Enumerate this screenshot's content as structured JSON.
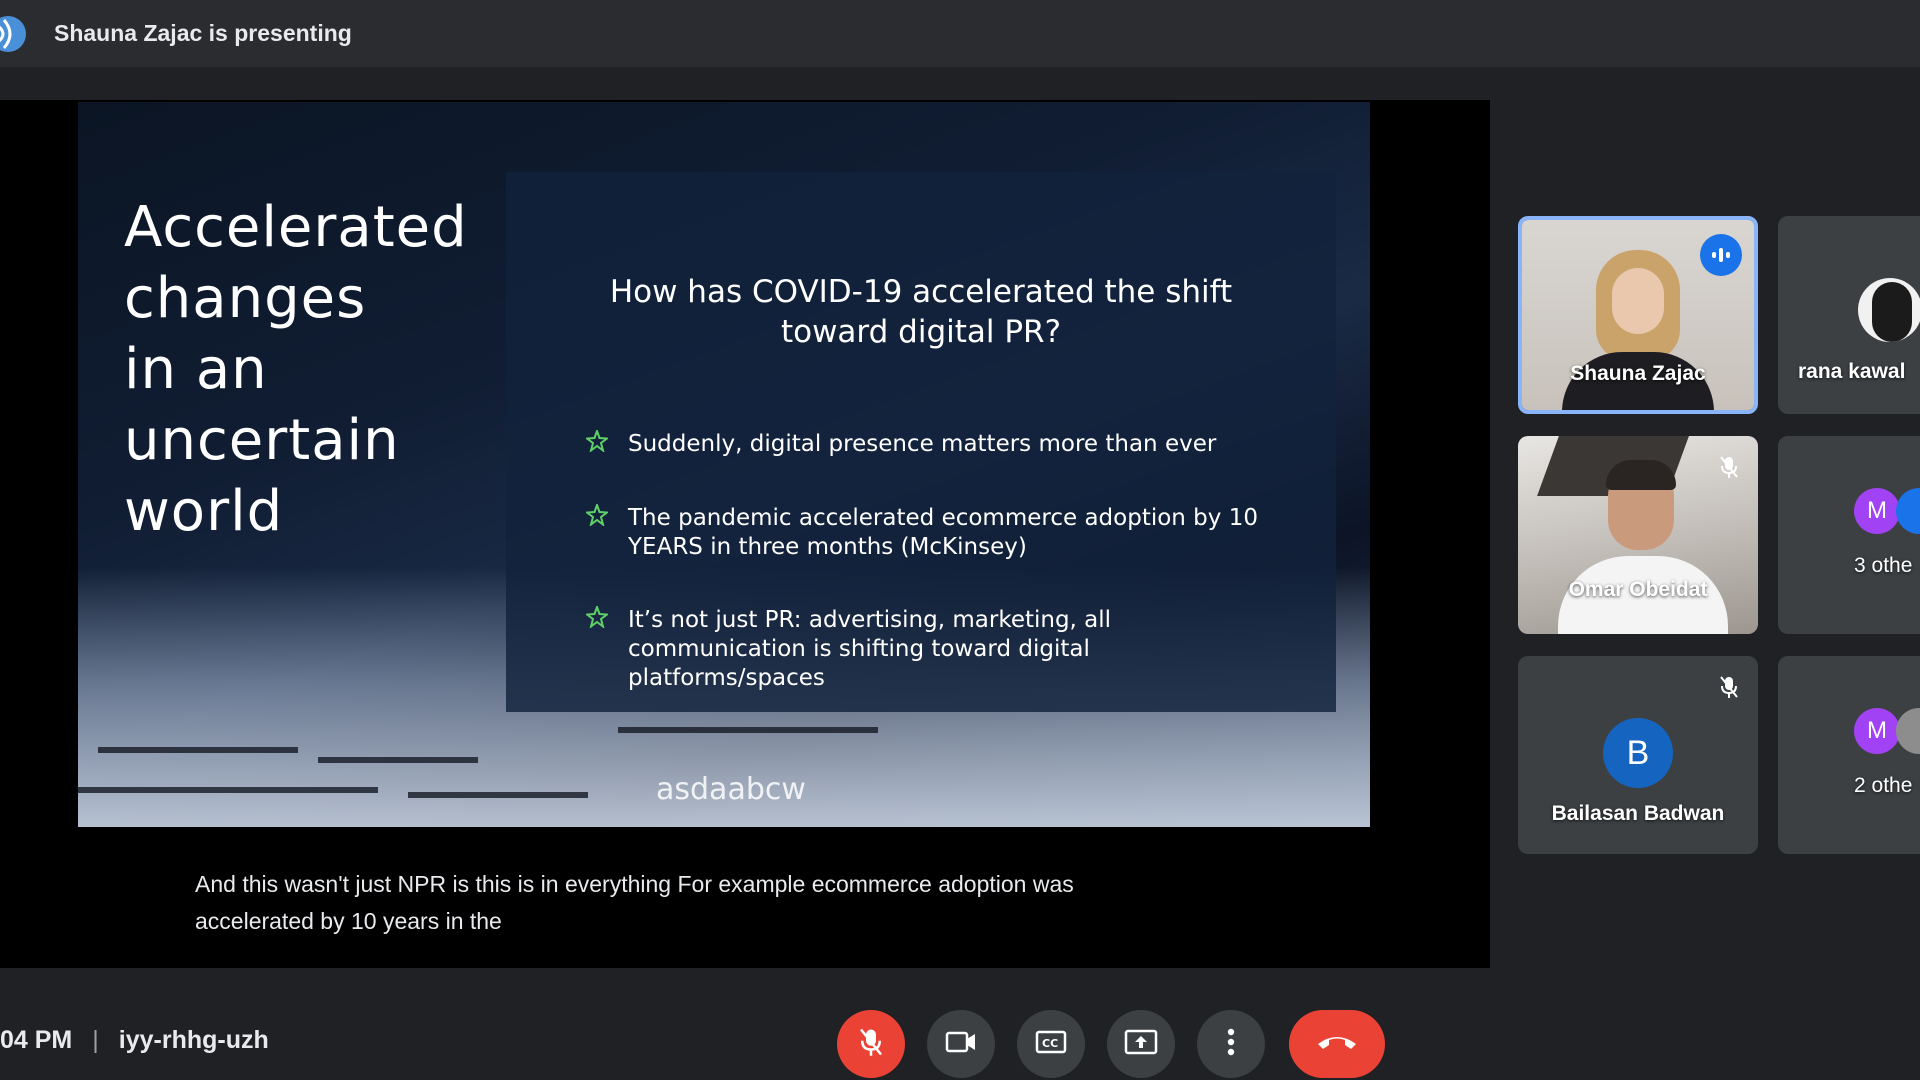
{
  "topbar": {
    "presenting": "Shauna Zajac is presenting"
  },
  "slide": {
    "title_lines": [
      "Accelerated",
      "changes",
      "in an",
      "uncertain",
      "world"
    ],
    "question": "How has COVID-19 accelerated the shift toward digital PR?",
    "bullets": [
      "Suddenly, digital presence matters more than ever",
      "The pandemic accelerated ecommerce adoption by 10 YEARS in three months (McKinsey)",
      "It’s not just PR: advertising, marketing, all communication is shifting toward digital platforms/spaces"
    ],
    "logo": "asdaabcw"
  },
  "captions": "And this wasn't just NPR is this is in everything For example ecommerce adoption was accelerated by 10 years in the",
  "participants": {
    "shauna": {
      "name": "Shauna Zajac"
    },
    "rana": {
      "name": "rana kawal"
    },
    "omar": {
      "name": "Omar Obeidat"
    },
    "others3": {
      "initial": "M",
      "label": "3 othe"
    },
    "bailasan": {
      "initial": "B",
      "name": "Bailasan Badwan"
    },
    "others2": {
      "initial": "M",
      "label": "2 othe"
    }
  },
  "bottom": {
    "time": "04 PM",
    "separator": "|",
    "meeting_code": "iyy-rhhg-uzh"
  },
  "colors": {
    "accent_blue": "#1a73e8",
    "end_red": "#ea4335",
    "tile_bg": "#3c4043"
  }
}
